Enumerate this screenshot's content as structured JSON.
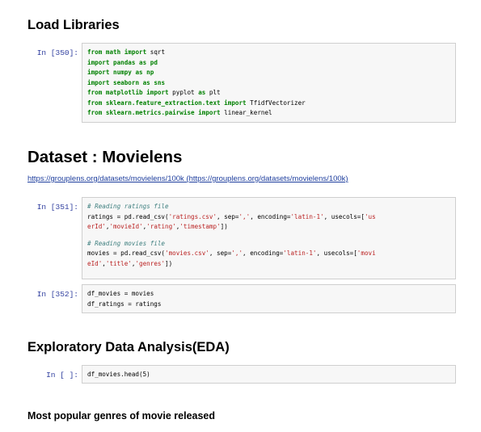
{
  "sections": {
    "load_libraries": "Load Libraries",
    "dataset": "Dataset : Movielens",
    "eda": "Exploratory Data Analysis(EDA)",
    "popular_genres": "Most popular genres of movie released"
  },
  "dataset_link": "https://grouplens.org/datasets/movielens/100k (https://grouplens.org/datasets/movielens/100k)",
  "cells": {
    "c350": {
      "prompt": "In [350]:",
      "l1": {
        "a": "from",
        "b": " math ",
        "c": "import",
        "d": " sqrt"
      },
      "l2": {
        "a": "import",
        "b": " pandas ",
        "c": "as",
        "d": " pd"
      },
      "l3": {
        "a": "import",
        "b": " numpy ",
        "c": "as",
        "d": " np"
      },
      "l4": {
        "a": "import",
        "b": " seaborn ",
        "c": "as",
        "d": " sns"
      },
      "l5": {
        "a": "from",
        "b": " matplotlib ",
        "c": "import",
        "d": " pyplot ",
        "e": "as",
        "f": " plt"
      },
      "l6": {
        "a": "from",
        "b": " sklearn.feature_extraction.text ",
        "c": "import",
        "d": " TfidfVectorizer"
      },
      "l7": {
        "a": "from",
        "b": " sklearn.metrics.pairwise ",
        "c": "import",
        "d": " linear_kernel"
      }
    },
    "c351": {
      "prompt": "In [351]:",
      "comment1": "# Reading ratings file",
      "r1": {
        "a": "ratings = pd.read_csv(",
        "b": "'ratings.csv'",
        "c": ", sep=",
        "d": "','",
        "e": ", encoding=",
        "f": "'latin-1'",
        "g": ", usecols=[",
        "h": "'us"
      },
      "r2": {
        "a": "erId'",
        "b": ",",
        "c": "'movieId'",
        "d": ",",
        "e": "'rating'",
        "f": ",",
        "g": "'timestamp'",
        "h": "])"
      },
      "comment2": "# Reading movies file",
      "m1": {
        "a": "movies = pd.read_csv(",
        "b": "'movies.csv'",
        "c": ", sep=",
        "d": "','",
        "e": ", encoding=",
        "f": "'latin-1'",
        "g": ", usecols=[",
        "h": "'movi"
      },
      "m2": {
        "a": "eId'",
        "b": ",",
        "c": "'title'",
        "d": ",",
        "e": "'genres'",
        "f": "])"
      }
    },
    "c352": {
      "prompt": "In [352]:",
      "l1": "df_movies = movies",
      "l2": "df_ratings = ratings"
    },
    "cempty": {
      "prompt": "In [ ]:",
      "l1": "df_movies.head(5)"
    }
  }
}
